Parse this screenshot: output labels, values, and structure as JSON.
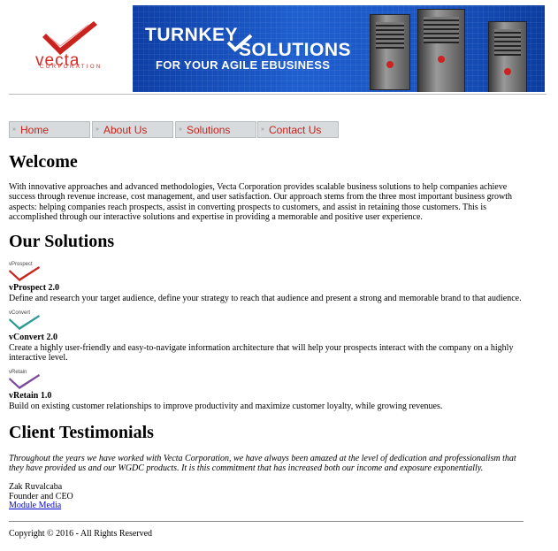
{
  "header": {
    "logo_text": "vecta",
    "logo_sub": "CORPORATION",
    "banner_line1": "TURNKEY",
    "banner_line2": "SOLUTIONS",
    "banner_line3": "FOR YOUR AGILE EBUSINESS"
  },
  "nav": {
    "items": [
      {
        "label": "Home",
        "icon": "nav-arrow-icon"
      },
      {
        "label": "About Us",
        "icon": "nav-arrow-icon"
      },
      {
        "label": "Solutions",
        "icon": "nav-arrow-icon"
      },
      {
        "label": "Contact Us",
        "icon": "nav-arrow-icon"
      }
    ]
  },
  "welcome": {
    "heading": "Welcome",
    "text": "With innovative approaches and advanced methodologies, Vecta Corporation provides scalable business solutions to help companies achieve success through revenue increase, cost management, and user satisfaction. Our approach stems from the three most important business growth aspects: helping companies reach prospects, assist in converting prospects to customers, and assist in retaining those customers. This is accomplished through our interactive solutions and expertise in providing a memorable and positive user experience."
  },
  "solutions": {
    "heading": "Our Solutions",
    "products": [
      {
        "tag": "vProspect",
        "name": "vProspect 2.0",
        "desc": "Define and research your target audience, define your strategy to reach that audience and present a strong and memorable brand to that audience.",
        "color": "#c8231c"
      },
      {
        "tag": "vConvert",
        "name": "vConvert 2.0",
        "desc": "Create a highly user-friendly and easy-to-navigate information architecture that will help your prospects interact with the company on a highly interactive level.",
        "color": "#2a9a94"
      },
      {
        "tag": "vRetain",
        "name": "vRetain 1.0",
        "desc": "Build on existing customer relationships to improve productivity and maximize customer loyalty, while growing revenues.",
        "color": "#7a4a9a"
      }
    ]
  },
  "testimonials": {
    "heading": "Client Testimonials",
    "quote": "Throughout the years we have worked with Vecta Corporation, we have always been amazed at the level of dedication and professionalism that they have provided us and our WGDC products. It is this commitment that has increased both our income and exposure exponentially.",
    "author": "Zak Ruvalcaba",
    "title": "Founder and CEO",
    "company_link": "Module Media"
  },
  "footer": {
    "copyright": "Copyright © 2016 - All Rights Reserved"
  },
  "colors": {
    "brand_red": "#c8231c",
    "banner_blue": "#1e5fd0",
    "nav_bg": "#d7dbdd"
  }
}
